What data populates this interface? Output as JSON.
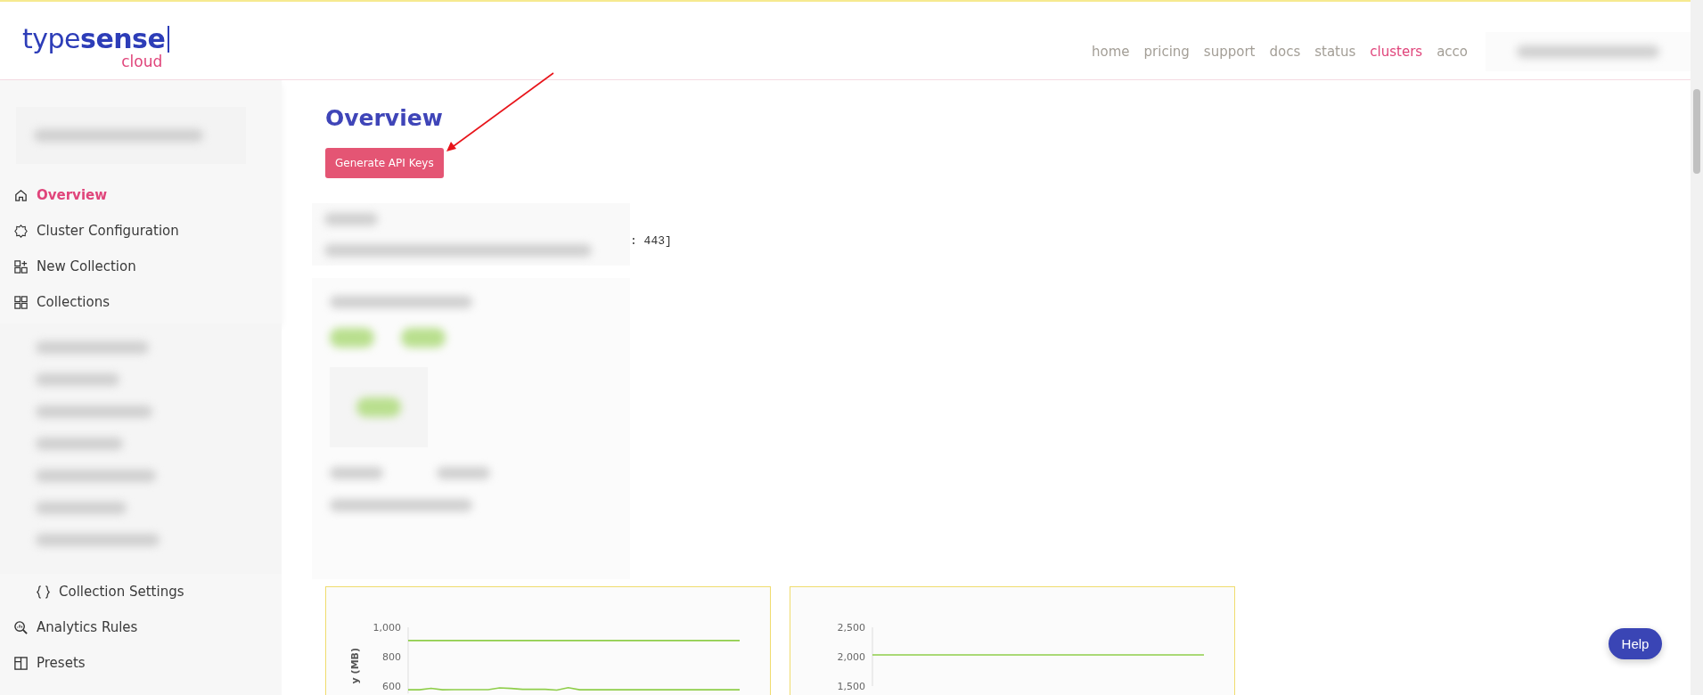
{
  "header": {
    "logo": {
      "wordmark": "type**sense**",
      "sub": "cloud"
    },
    "nav": [
      {
        "label": "home",
        "selected": false
      },
      {
        "label": "pricing",
        "selected": false
      },
      {
        "label": "support",
        "selected": false
      },
      {
        "label": "docs",
        "selected": false
      },
      {
        "label": "status",
        "selected": false
      },
      {
        "label": "clusters",
        "selected": true
      },
      {
        "label": "acco",
        "selected": false
      }
    ]
  },
  "sidebar": {
    "items": [
      {
        "label": "Overview",
        "selected": true
      },
      {
        "label": "Cluster Configuration",
        "selected": false
      },
      {
        "label": "New Collection",
        "selected": false
      },
      {
        "label": "Collections",
        "selected": false,
        "children": [
          {
            "label": "Collection Settings",
            "selected": false
          }
        ]
      },
      {
        "label": "Analytics Rules",
        "selected": false
      },
      {
        "label": "Presets",
        "selected": false
      }
    ]
  },
  "main": {
    "title": "Overview",
    "button": "Generate API Keys",
    "endpoint_tail": ": 443]",
    "charts": [
      {
        "chart_data": {
          "type": "line",
          "ylabel": "y (MB)",
          "ylim": [
            550,
            1000
          ],
          "yticks": [
            {
              "value": 600,
              "label": "600"
            },
            {
              "value": 800,
              "label": "800"
            },
            {
              "value": 1000,
              "label": "1,000"
            }
          ],
          "series": [
            {
              "color": "#8fce4a",
              "values": [
                910,
                910,
                910,
                910,
                910,
                910,
                910,
                910,
                910,
                910,
                910,
                910,
                910,
                910,
                910,
                910,
                910,
                910,
                910,
                910,
                910,
                910,
                910,
                910,
                910,
                910,
                910,
                910,
                910,
                910
              ]
            },
            {
              "color": "#8fce4a",
              "values": [
                575,
                575,
                585,
                575,
                576,
                576,
                576,
                576,
                588,
                584,
                578,
                578,
                578,
                573,
                590,
                575,
                575,
                575,
                575,
                575,
                575,
                575,
                575,
                575,
                575,
                575,
                575,
                575,
                575,
                575
              ]
            }
          ]
        }
      },
      {
        "chart_data": {
          "type": "line",
          "ylim": [
            1500,
            2500
          ],
          "yticks": [
            {
              "value": 1500,
              "label": "1,500"
            },
            {
              "value": 2000,
              "label": "2,000"
            },
            {
              "value": 2500,
              "label": "2,500"
            }
          ],
          "series": [
            {
              "color": "#8fce4a",
              "values": [
                2030,
                2030,
                2030,
                2030,
                2030,
                2030,
                2030,
                2030,
                2030,
                2030,
                2030,
                2030,
                2030,
                2030,
                2030,
                2030,
                2030,
                2030,
                2030,
                2030
              ]
            }
          ]
        }
      }
    ]
  },
  "help_button": "Help"
}
